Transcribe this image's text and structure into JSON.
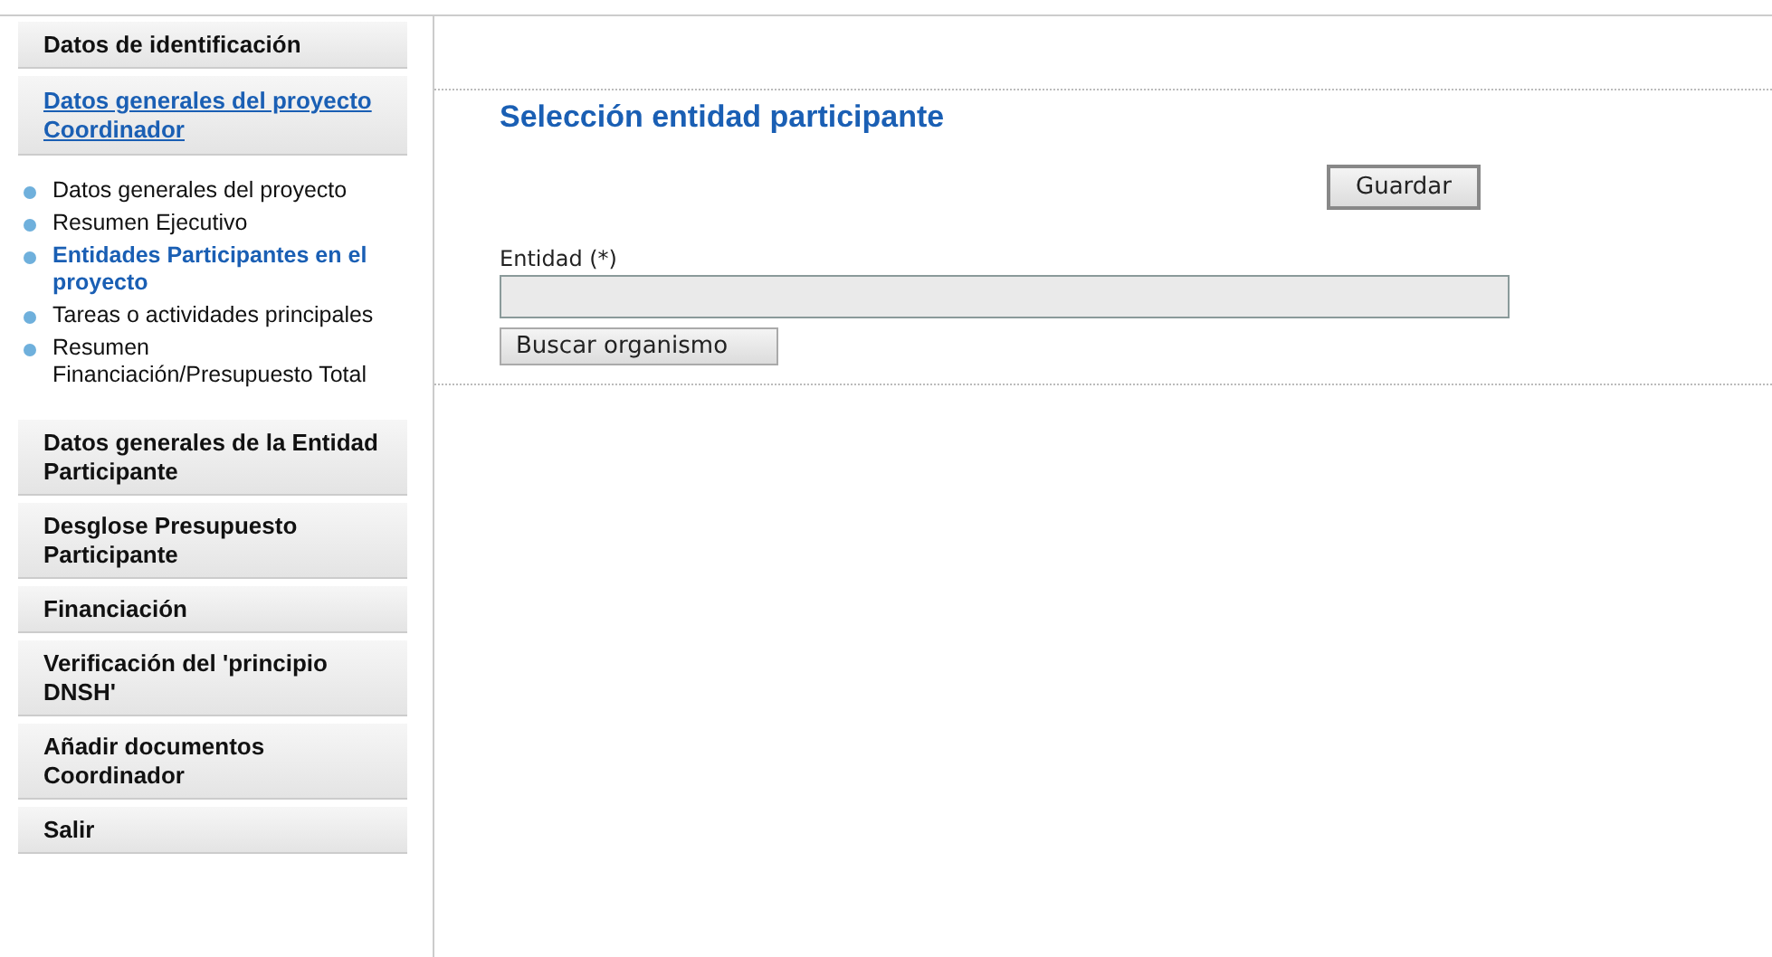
{
  "sidebar": {
    "title": "Datos de identificación",
    "items": [
      {
        "label": "Datos generales del proyecto Coordinador",
        "selected": true,
        "children": [
          {
            "label": "Datos generales del proyecto",
            "selected": false
          },
          {
            "label": "Resumen Ejecutivo",
            "selected": false
          },
          {
            "label": "Entidades Participantes en el proyecto",
            "selected": true
          },
          {
            "label": "Tareas o actividades principales",
            "selected": false
          },
          {
            "label": "Resumen Financiación/Presupuesto Total",
            "selected": false
          }
        ]
      },
      {
        "label": "Datos generales de la Entidad Participante",
        "selected": false
      },
      {
        "label": "Desglose Presupuesto Participante",
        "selected": false
      },
      {
        "label": "Financiación",
        "selected": false
      },
      {
        "label": "Verificación del 'principio DNSH'",
        "selected": false
      },
      {
        "label": "Añadir documentos Coordinador",
        "selected": false
      },
      {
        "label": "Salir",
        "selected": false
      }
    ]
  },
  "main": {
    "heading": "Selección entidad participante",
    "save_button": "Guardar",
    "field": {
      "label": "Entidad (*)"
    },
    "search_button": "Buscar organismo"
  }
}
